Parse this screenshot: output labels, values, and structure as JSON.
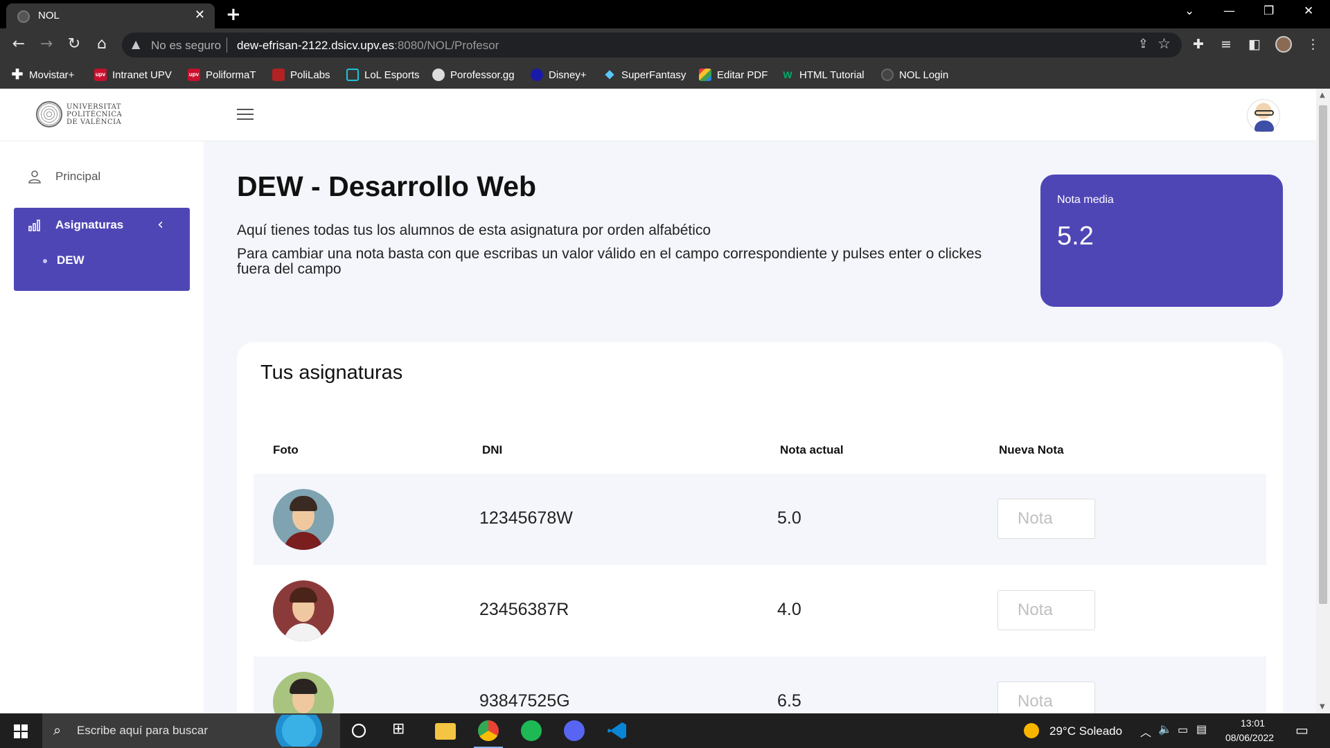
{
  "browser": {
    "tab_title": "NOL",
    "new_tab": "+",
    "security_label": "No es seguro",
    "url_host": "dew-efrisan-2122.dsicv.upv.es",
    "url_path": ":8080/NOL/Profesor",
    "bookmarks": [
      {
        "label": "Movistar+",
        "icon": "plus-icon",
        "color": "#ffffff"
      },
      {
        "label": "Intranet UPV",
        "icon": "upv-icon",
        "color": "#c8102e"
      },
      {
        "label": "PoliformaT",
        "icon": "upv-icon",
        "color": "#c8102e"
      },
      {
        "label": "PoliLabs",
        "icon": "polilabs-icon",
        "color": "#b22222"
      },
      {
        "label": "LoL Esports",
        "icon": "lol-icon",
        "color": "#1cc4d8"
      },
      {
        "label": "Porofessor.gg",
        "icon": "poro-icon",
        "color": "#dddddd"
      },
      {
        "label": "Disney+",
        "icon": "disney-icon",
        "color": "#1a1aa8"
      },
      {
        "label": "SuperFantasy",
        "icon": "superfantasy-icon",
        "color": "#5ac8fa"
      },
      {
        "label": "Editar PDF",
        "icon": "pdf-icon",
        "color": "#e53935"
      },
      {
        "label": "HTML Tutorial",
        "icon": "w3-icon",
        "color": "#04aa6d"
      },
      {
        "label": "NOL Login",
        "icon": "nol-icon",
        "color": "#555555"
      }
    ]
  },
  "header": {
    "logo_lines": [
      "UNIVERSITAT",
      "POLITÈCNICA",
      "DE VALÈNCIA"
    ]
  },
  "sidebar": {
    "principal": "Principal",
    "asignaturas": "Asignaturas",
    "sub_items": [
      "DEW"
    ]
  },
  "main": {
    "title": "DEW - Desarrollo Web",
    "desc1": "Aquí tienes todas tus los alumnos de esta asignatura por orden alfabético",
    "desc2": "Para cambiar una nota basta con que escribas un valor válido en el campo correspondiente y pulses enter o clickes fuera del campo",
    "nota_media_label": "Nota media",
    "nota_media_value": "5.2",
    "table_title": "Tus asignaturas",
    "columns": [
      "Foto",
      "DNI",
      "Nota actual",
      "Nueva Nota"
    ],
    "rows": [
      {
        "dni": "12345678W",
        "nota": "5.0",
        "placeholder": "Nota",
        "bg": "#7fa3b0",
        "hair": "#3a2a22",
        "torso": "#7a1e1e"
      },
      {
        "dni": "23456387R",
        "nota": "4.0",
        "placeholder": "Nota",
        "bg": "#8b3a3a",
        "hair": "#4a2418",
        "torso": "#f2f2f2"
      },
      {
        "dni": "93847525G",
        "nota": "6.5",
        "placeholder": "Nota",
        "bg": "#a9c47f",
        "hair": "#2a2420",
        "torso": "#3d6b3d"
      }
    ]
  },
  "taskbar": {
    "search_placeholder": "Escribe aquí para buscar",
    "weather": "29°C  Soleado",
    "time": "13:01",
    "date": "08/06/2022"
  }
}
